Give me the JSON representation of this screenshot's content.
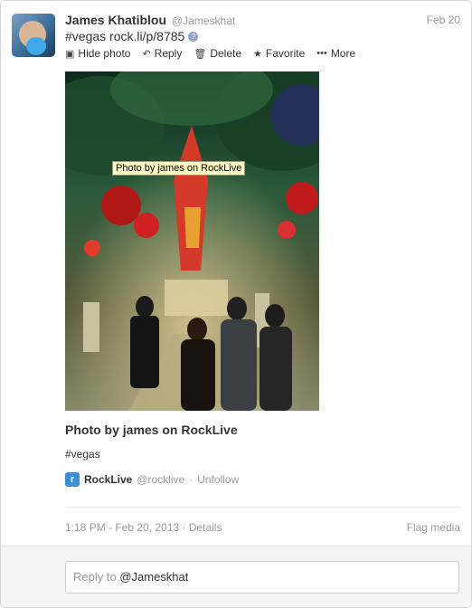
{
  "tweet": {
    "author_name": "James Khatiblou",
    "author_handle": "@Jameskhat",
    "date": "Feb 20",
    "text": "#vegas rock.li/p/8785",
    "link_badge_icon": "link-info-icon"
  },
  "actions": [
    {
      "label": "Hide photo",
      "icon": "photo-icon"
    },
    {
      "label": "Reply",
      "icon": "reply-icon"
    },
    {
      "label": "Delete",
      "icon": "trash-icon"
    },
    {
      "label": "Favorite",
      "icon": "star-icon"
    },
    {
      "label": "More",
      "icon": "ellipsis-icon"
    }
  ],
  "photo": {
    "tooltip": "Photo by james on RockLive"
  },
  "card": {
    "title": "Photo by james on RockLive",
    "hashtag": "#vegas",
    "app_icon_letter": "r",
    "app_name": "RockLive",
    "app_handle": "@rocklive",
    "separator": "·",
    "unfollow_label": "Unfollow"
  },
  "meta": {
    "timestamp": "1:18 PM - Feb 20, 2013",
    "separator": "·",
    "details_label": "Details",
    "flag_label": "Flag media"
  },
  "reply": {
    "prefix": "Reply to ",
    "mention": "@Jameskhat"
  },
  "colors": {
    "link_blue": "#3a8ed6",
    "muted": "#999999",
    "tooltip_bg": "#fdfac4"
  }
}
